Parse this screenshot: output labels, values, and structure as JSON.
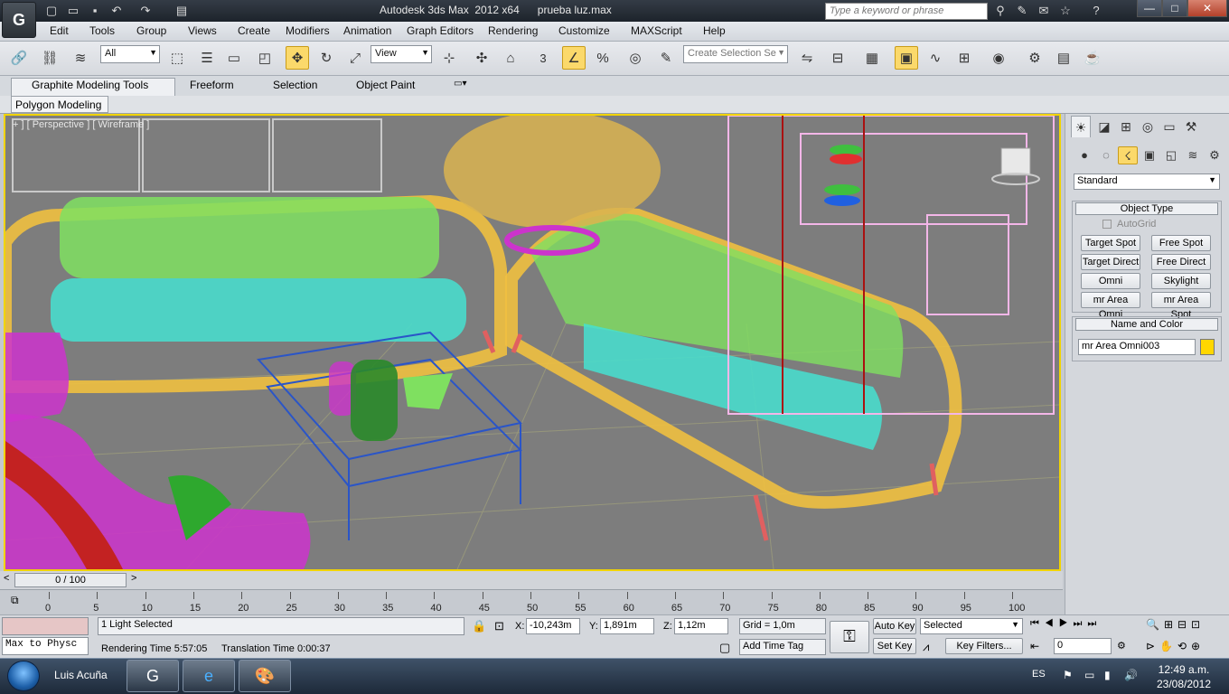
{
  "window": {
    "title": "Autodesk 3ds Max  2012 x64      prueba luz.max",
    "search_placeholder": "Type a keyword or phrase",
    "min": "—",
    "max": "□",
    "close": "✕"
  },
  "menu": [
    "Edit",
    "Tools",
    "Group",
    "Views",
    "Create",
    "Modifiers",
    "Animation",
    "Graph Editors",
    "Rendering",
    "Customize",
    "MAXScript",
    "Help"
  ],
  "toolbar": {
    "filter_dropdown": "All",
    "refcoord_dropdown": "View",
    "snap_count": "3",
    "selection_set_placeholder": "Create Selection Se"
  },
  "ribbon": {
    "tabs": [
      "Graphite Modeling Tools",
      "Freeform",
      "Selection",
      "Object Paint"
    ],
    "panel_tab": "Polygon Modeling"
  },
  "viewport": {
    "label": "+ ] [ Perspective ] [ Wireframe ]",
    "accent": "#f1d400"
  },
  "command_panel": {
    "category_dropdown": "Standard",
    "object_type_title": "Object Type",
    "autogrid": "AutoGrid",
    "buttons": [
      "Target Spot",
      "Free Spot",
      "Target Direct",
      "Free Direct",
      "Omni",
      "Skylight",
      "mr Area Omni",
      "mr Area Spot"
    ],
    "name_color_title": "Name and Color",
    "object_name": "mr Area Omni003",
    "object_color": "#ffd700"
  },
  "timeline": {
    "slider_label": "0 / 100",
    "ticks": [
      "0",
      "5",
      "10",
      "15",
      "20",
      "25",
      "30",
      "35",
      "40",
      "45",
      "50",
      "55",
      "60",
      "65",
      "70",
      "75",
      "80",
      "85",
      "90",
      "95",
      "100"
    ]
  },
  "status": {
    "maxscript": "Max to Physc",
    "selection_info": "1 Light Selected",
    "render_time_label": "Rendering Time  5:57:05",
    "translation_time": "Translation Time  0:00:37",
    "x_label": "X:",
    "x_value": "-10,243m",
    "y_label": "Y:",
    "y_value": "1,891m",
    "z_label": "Z:",
    "z_value": "1,12m",
    "grid": "Grid = 1,0m",
    "add_time_tag": "Add Time Tag",
    "auto_key": "Auto Key",
    "set_key": "Set Key",
    "selected_dropdown": "Selected",
    "key_filters": "Key Filters...",
    "frame": "0"
  },
  "taskbar": {
    "user": "Luis Acuña",
    "lang": "ES",
    "time": "12:49 a.m.",
    "date": "23/08/2012"
  }
}
